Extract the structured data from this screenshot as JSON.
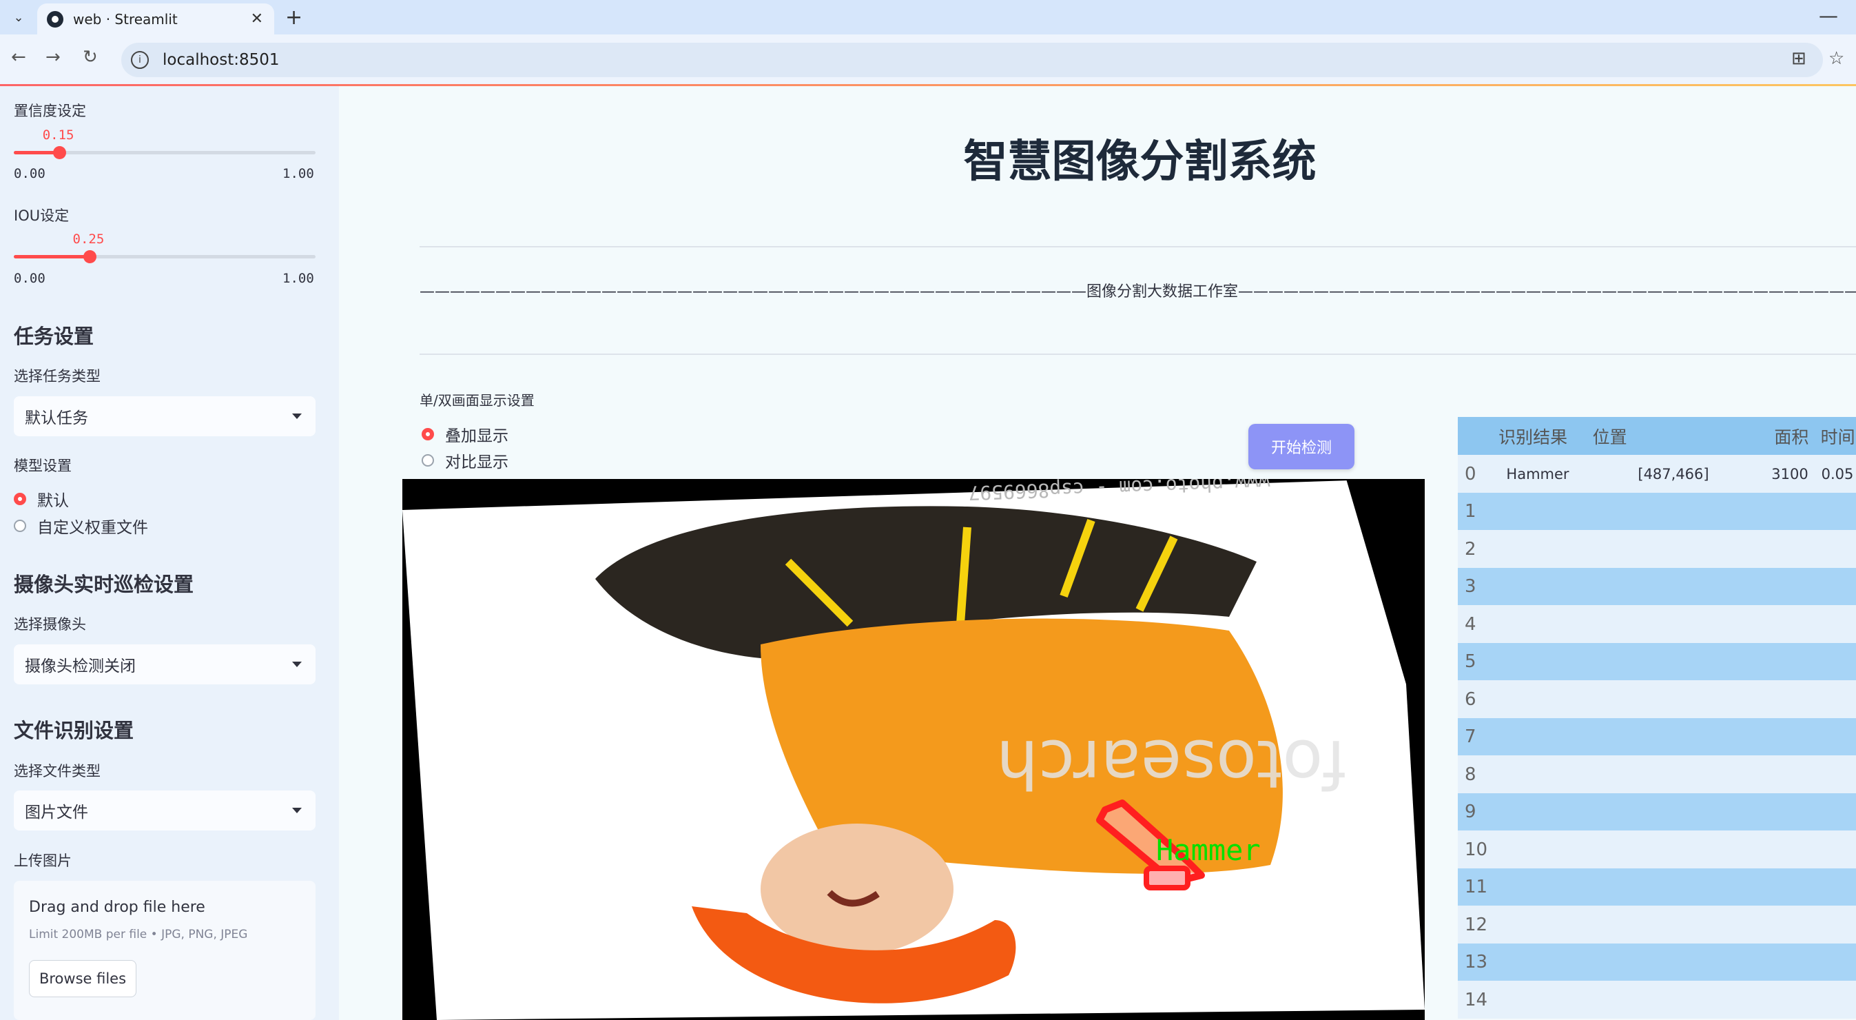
{
  "browser": {
    "tab_title": "web · Streamlit",
    "url": "localhost:8501"
  },
  "sidebar": {
    "confidence": {
      "label": "置信度设定",
      "value": "0.15",
      "level": 0.15,
      "min": "0.00",
      "max": "1.00"
    },
    "iou": {
      "label": "IOU设定",
      "value": "0.25",
      "level": 0.25,
      "min": "0.00",
      "max": "1.00"
    },
    "task_heading": "任务设置",
    "task_type_label": "选择任务类型",
    "task_type_value": "默认任务",
    "model_label": "模型设置",
    "model_options": [
      "默认",
      "自定义权重文件"
    ],
    "camera_heading": "摄像头实时巡检设置",
    "camera_label": "选择摄像头",
    "camera_value": "摄像头检测关闭",
    "file_heading": "文件识别设置",
    "file_type_label": "选择文件类型",
    "file_type_value": "图片文件",
    "upload_label": "上传图片",
    "upload_main": "Drag and drop file here",
    "upload_sub": "Limit 200MB per file • JPG, PNG, JPEG",
    "upload_button": "Browse files"
  },
  "main": {
    "title": "智慧图像分割系统",
    "studio_line": "————————————————————————————————————————————图像分割大数据工作室————————————————————————————————————————————",
    "display_label": "单/双画面显示设置",
    "display_options": [
      "叠加显示",
      "对比显示"
    ],
    "detect_button": "开始检测",
    "image": {
      "watermark_top": "www.photo.com - csp8669597",
      "watermark_mid": "fotosearch",
      "detection_label": "Hammer",
      "colors": {
        "mask": "#ff1f1f",
        "label": "#00e000",
        "overalls": "#f49a1c",
        "helmet": "#f35a12"
      }
    }
  },
  "table": {
    "headers": [
      "识别结果",
      "位置",
      "面积",
      "时间"
    ],
    "rows": [
      {
        "idx": "0",
        "result": "Hammer",
        "position": "[487,466]",
        "area": "3100",
        "time": "0.05"
      },
      {
        "idx": "1",
        "result": "",
        "position": "",
        "area": "",
        "time": ""
      },
      {
        "idx": "2",
        "result": "",
        "position": "",
        "area": "",
        "time": ""
      },
      {
        "idx": "3",
        "result": "",
        "position": "",
        "area": "",
        "time": ""
      },
      {
        "idx": "4",
        "result": "",
        "position": "",
        "area": "",
        "time": ""
      },
      {
        "idx": "5",
        "result": "",
        "position": "",
        "area": "",
        "time": ""
      },
      {
        "idx": "6",
        "result": "",
        "position": "",
        "area": "",
        "time": ""
      },
      {
        "idx": "7",
        "result": "",
        "position": "",
        "area": "",
        "time": ""
      },
      {
        "idx": "8",
        "result": "",
        "position": "",
        "area": "",
        "time": ""
      },
      {
        "idx": "9",
        "result": "",
        "position": "",
        "area": "",
        "time": ""
      },
      {
        "idx": "10",
        "result": "",
        "position": "",
        "area": "",
        "time": ""
      },
      {
        "idx": "11",
        "result": "",
        "position": "",
        "area": "",
        "time": ""
      },
      {
        "idx": "12",
        "result": "",
        "position": "",
        "area": "",
        "time": ""
      },
      {
        "idx": "13",
        "result": "",
        "position": "",
        "area": "",
        "time": ""
      },
      {
        "idx": "14",
        "result": "",
        "position": "",
        "area": "",
        "time": ""
      }
    ]
  }
}
